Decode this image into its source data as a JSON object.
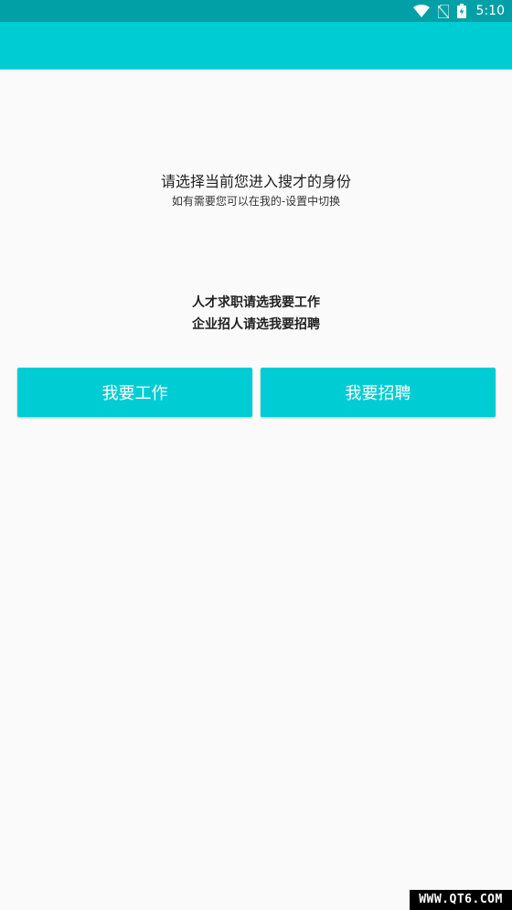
{
  "status_bar": {
    "time": "5:10",
    "icons": [
      "wifi-icon",
      "no-sim-icon",
      "battery-charging-icon"
    ]
  },
  "colors": {
    "status_bar": "#00a0a6",
    "accent": "#00cdd3",
    "background": "#fafafa"
  },
  "prompt": {
    "title": "请选择当前您进入搜才的身份",
    "subtitle": "如有需要您可以在我的-设置中切换"
  },
  "hints": {
    "line1": "人才求职请选我要工作",
    "line2": "企业招人请选我要招聘"
  },
  "buttons": {
    "work_label": "我要工作",
    "hire_label": "我要招聘"
  },
  "watermark": {
    "text": "WWW.QT6.COM"
  }
}
